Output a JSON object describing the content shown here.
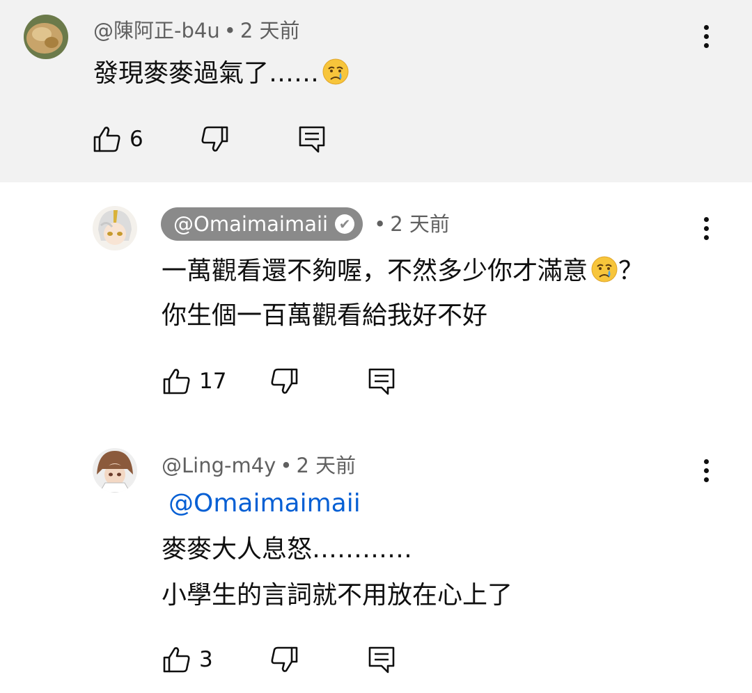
{
  "comments": [
    {
      "author": "@陳阿正-b4u",
      "separator": "•",
      "time": "2 天前",
      "lines": [
        "發現麥麥過氣了……"
      ],
      "emoji_name": "crying-face",
      "likes": "6",
      "background": "#f2f2f2"
    },
    {
      "author": "@Omaimaimaii",
      "verified": true,
      "separator": "•",
      "time": "2 天前",
      "lines": [
        "一萬觀看還不夠喔，不然多少你才滿意",
        "？",
        "你生個一百萬觀看給我好不好"
      ],
      "emoji_name": "crying-face",
      "likes": "17"
    },
    {
      "author": "@Ling-m4y",
      "separator": "•",
      "time": "2 天前",
      "mention": "@Omaimaimaii",
      "lines": [
        "麥麥大人息怒…………",
        "小學生的言詞就不用放在心上了"
      ],
      "likes": "3"
    }
  ],
  "colors": {
    "highlight_background": "#f2f2f2",
    "meta_text": "#606060",
    "mention": "#065fd4",
    "pill": "#8a8a8a"
  },
  "icons": {
    "like": "thumbs-up-icon",
    "dislike": "thumbs-down-icon",
    "reply": "reply-icon",
    "menu": "more-vert-icon"
  }
}
